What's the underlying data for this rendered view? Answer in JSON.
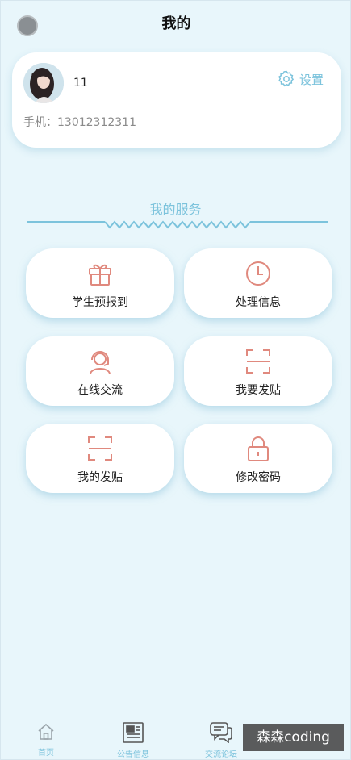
{
  "header": {
    "title": "我的"
  },
  "profile": {
    "username": "11",
    "settings_label": "设置",
    "phone_label": "手机：",
    "phone": "13012312311"
  },
  "services": {
    "title": "我的服务",
    "items": [
      {
        "label": "学生预报到",
        "icon": "gift-icon"
      },
      {
        "label": "处理信息",
        "icon": "clock-icon"
      },
      {
        "label": "在线交流",
        "icon": "headset-support-icon"
      },
      {
        "label": "我要发贴",
        "icon": "scan-frame-icon"
      },
      {
        "label": "我的发贴",
        "icon": "scan-frame-icon"
      },
      {
        "label": "修改密码",
        "icon": "lock-icon"
      }
    ]
  },
  "tabbar": {
    "items": [
      {
        "label": "首页",
        "icon": "home-icon"
      },
      {
        "label": "公告信息",
        "icon": "news-icon"
      },
      {
        "label": "交流论坛",
        "icon": "chat-icon"
      }
    ]
  },
  "watermark": "森森coding",
  "colors": {
    "background": "#e8f6fb",
    "accent": "#7cc3dc",
    "icon": "#e0897e"
  }
}
